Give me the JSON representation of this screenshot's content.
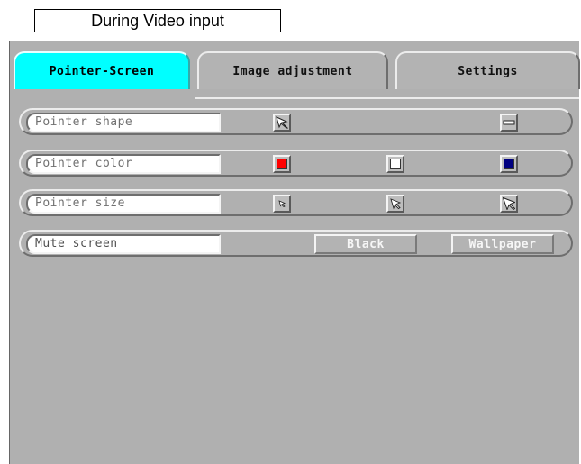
{
  "caption": "During Video input",
  "tabs": [
    {
      "label": "Pointer-Screen",
      "active": true
    },
    {
      "label": "Image adjustment",
      "active": false
    },
    {
      "label": "Settings",
      "active": false
    }
  ],
  "rows": {
    "pointer_shape": {
      "label": "Pointer shape",
      "options": [
        "arrow-pointer-icon",
        "bar-pointer-icon"
      ]
    },
    "pointer_color": {
      "label": "Pointer color",
      "colors": [
        "#ff0000",
        "#ffffff",
        "#000080"
      ]
    },
    "pointer_size": {
      "label": "Pointer size",
      "options": [
        "small-pointer-icon",
        "medium-pointer-icon",
        "large-pointer-icon"
      ]
    },
    "mute_screen": {
      "label": "Mute screen",
      "black_label": "Black",
      "wallpaper_label": "Wallpaper"
    }
  }
}
